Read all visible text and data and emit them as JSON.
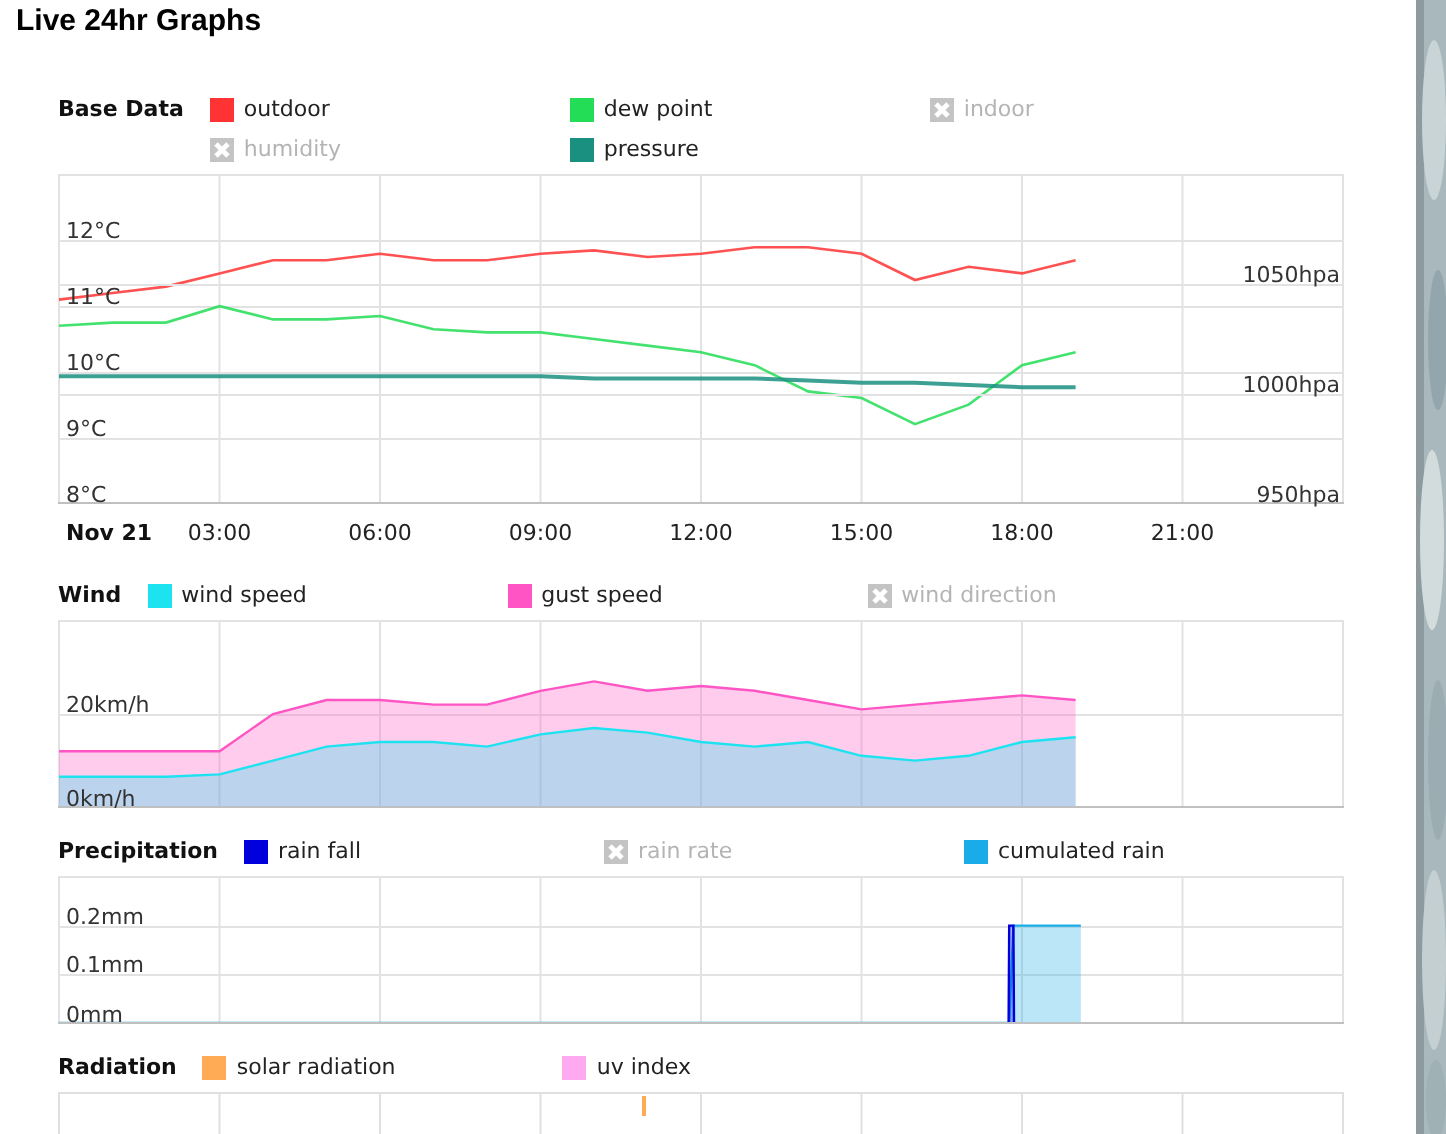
{
  "title": "Live 24hr Graphs",
  "sections": [
    {
      "title": "Base Data",
      "legend": [
        {
          "kind": "series",
          "hidden": false
        },
        {
          "kind": "series",
          "hidden": false
        },
        {
          "kind": "label",
          "label": "indoor",
          "hidden": true
        },
        {
          "kind": "label",
          "label": "humidity",
          "hidden": true
        },
        {
          "kind": "series",
          "hidden": false
        }
      ],
      "chart_data": {
        "type": "line",
        "grid": true,
        "xlim": [
          0,
          24
        ],
        "ylim": [
          8,
          13
        ],
        "xticks": [
          {
            "value": 0,
            "label": "Nov 21"
          },
          {
            "value": 3,
            "label": "03:00"
          },
          {
            "value": 6,
            "label": "06:00"
          },
          {
            "value": 9,
            "label": "09:00"
          },
          {
            "value": 12,
            "label": "12:00"
          },
          {
            "value": 15,
            "label": "15:00"
          },
          {
            "value": 18,
            "label": "18:00"
          },
          {
            "value": 21,
            "label": "21:00"
          }
        ],
        "yticks": [
          {
            "value": 8,
            "label": "8°C"
          },
          {
            "value": 9,
            "label": "9°C"
          },
          {
            "value": 10,
            "label": "10°C"
          },
          {
            "value": 11,
            "label": "11°C"
          },
          {
            "value": 12,
            "label": "12°C"
          }
        ],
        "x": [
          0,
          1,
          2,
          3,
          4,
          5,
          6,
          7,
          8,
          9,
          10,
          11,
          12,
          13,
          14,
          15,
          16,
          17,
          18,
          19
        ],
        "series": [
          {
            "name": "outdoor",
            "color": "#ff3333",
            "values": [
              11.1,
              11.2,
              11.3,
              11.5,
              11.7,
              11.7,
              11.8,
              11.7,
              11.7,
              11.8,
              11.85,
              11.75,
              11.8,
              11.9,
              11.9,
              11.8,
              11.4,
              11.6,
              11.5,
              11.7
            ]
          },
          {
            "name": "dew point",
            "color": "#22dd55",
            "values": [
              10.7,
              10.75,
              10.75,
              11.0,
              10.8,
              10.8,
              10.85,
              10.65,
              10.6,
              10.6,
              10.5,
              10.4,
              10.3,
              10.1,
              9.7,
              9.6,
              9.2,
              9.5,
              10.1,
              10.3
            ]
          }
        ]
      },
      "pressure_chart": {
        "chart_data": {
          "type": "line",
          "grid": true,
          "xlim": [
            0,
            24
          ],
          "ylim": [
            950,
            1100
          ],
          "yticks": [
            {
              "value": 950,
              "label": "950hpa"
            },
            {
              "value": 1000,
              "label": "1000hpa"
            },
            {
              "value": 1050,
              "label": "1050hpa"
            }
          ],
          "x": [
            0,
            1,
            2,
            3,
            4,
            5,
            6,
            7,
            8,
            9,
            10,
            11,
            12,
            13,
            14,
            15,
            16,
            17,
            18,
            19
          ],
          "series": [
            {
              "name": "pressure",
              "color": "#1a9080",
              "values": [
                1008,
                1008,
                1008,
                1008,
                1008,
                1008,
                1008,
                1008,
                1008,
                1008,
                1007,
                1007,
                1007,
                1007,
                1006,
                1005,
                1005,
                1004,
                1003,
                1003
              ]
            }
          ]
        }
      }
    },
    {
      "title": "Wind",
      "legend": [
        {
          "kind": "series",
          "hidden": false
        },
        {
          "kind": "series",
          "hidden": false
        },
        {
          "kind": "label",
          "label": "wind direction",
          "hidden": true
        }
      ],
      "chart_data": {
        "type": "area",
        "grid": true,
        "xlim": [
          0,
          24
        ],
        "ylim": [
          0,
          40
        ],
        "yticks": [
          {
            "value": 0,
            "label": "0km/h"
          },
          {
            "value": 20,
            "label": "20km/h"
          }
        ],
        "x": [
          0,
          1,
          2,
          3,
          4,
          5,
          6,
          7,
          8,
          9,
          10,
          11,
          12,
          13,
          14,
          15,
          16,
          17,
          18,
          19
        ],
        "series": [
          {
            "name": "wind speed",
            "color": "#1de3f0",
            "values": [
              6.5,
              6.5,
              6.5,
              7,
              10,
              13,
              14,
              14,
              13,
              15.6,
              17,
              16,
              14,
              13,
              14,
              11,
              10,
              11,
              14,
              15
            ]
          },
          {
            "name": "gust speed",
            "color": "#ff55c4",
            "values": [
              12,
              12,
              12,
              12,
              20,
              23,
              23,
              22,
              22,
              25,
              27,
              25,
              26,
              25,
              23,
              21,
              22,
              23,
              24,
              23
            ]
          }
        ]
      }
    },
    {
      "title": "Precipitation",
      "legend": [
        {
          "kind": "series",
          "hidden": false
        },
        {
          "kind": "label",
          "label": "rain rate",
          "hidden": true
        },
        {
          "kind": "series",
          "hidden": false
        }
      ],
      "chart_data": {
        "type": "area",
        "grid": true,
        "xlim": [
          0,
          24
        ],
        "ylim": [
          0,
          0.3
        ],
        "yticks": [
          {
            "value": 0,
            "label": "0mm"
          },
          {
            "value": 0.1,
            "label": "0.1mm"
          },
          {
            "value": 0.2,
            "label": "0.2mm"
          }
        ],
        "x": [
          0,
          17.75,
          17.76,
          17.84,
          17.85,
          19.1
        ],
        "series": [
          {
            "name": "rain fall",
            "color": "#0000dd",
            "values": [
              null,
              0,
              0.2,
              0.2,
              0,
              null
            ]
          },
          {
            "name": "cumulated rain",
            "color": "#1aace8",
            "values": [
              0,
              0,
              0,
              0.2,
              0.2,
              0.2
            ]
          }
        ]
      }
    },
    {
      "title": "Radiation",
      "legend": [
        {
          "kind": "label",
          "label": "solar radiation",
          "color": "#ffaa55",
          "hidden": false
        },
        {
          "kind": "label",
          "label": "uv index",
          "color": "#ffaaf0",
          "hidden": false
        }
      ]
    }
  ]
}
